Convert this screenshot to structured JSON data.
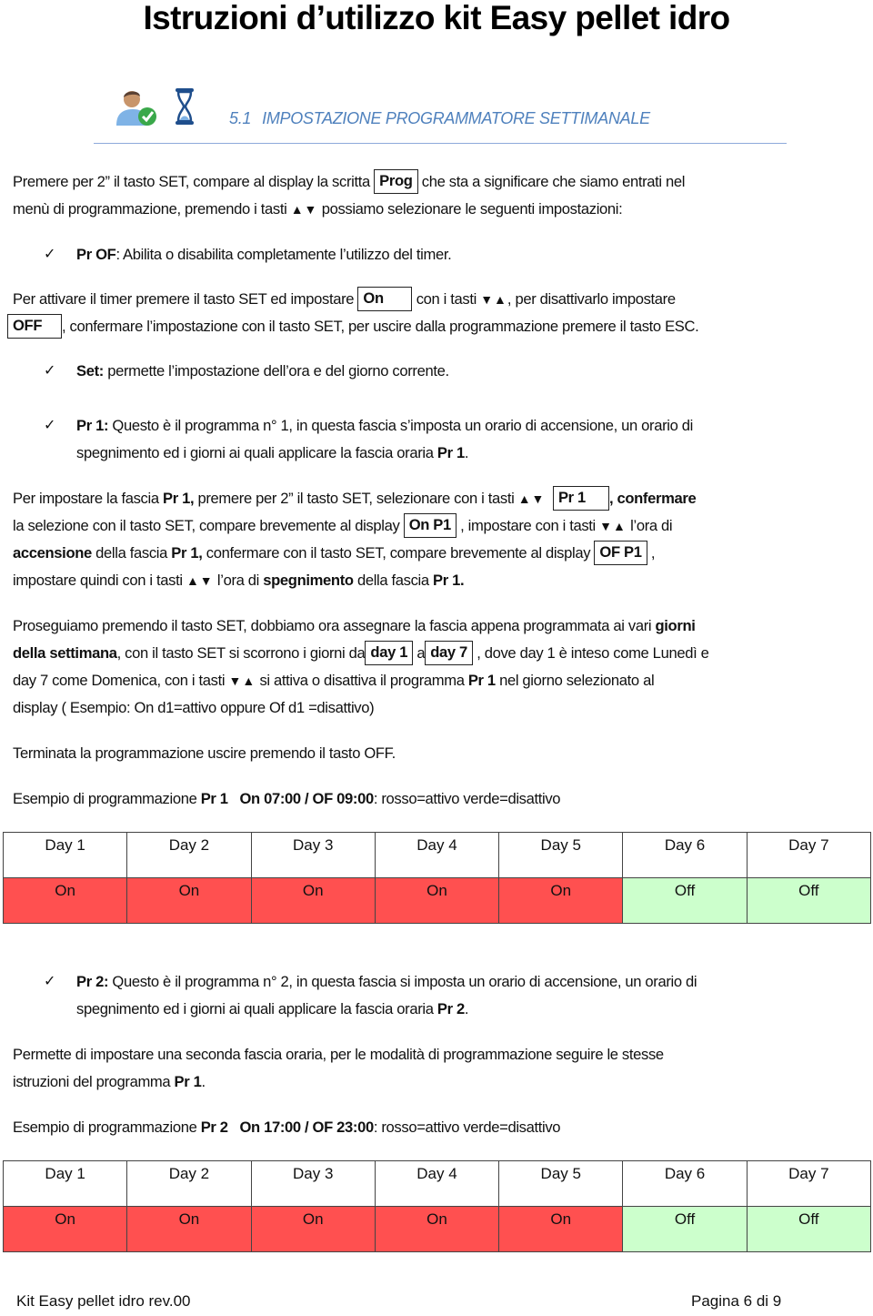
{
  "document": {
    "title": "Istruzioni d’utilizzo kit Easy pellet idro",
    "section": {
      "number": "5.1",
      "title": "IMPOSTAZIONE PROGRAMMATORE SETTIMANALE",
      "color": "#4f81bd"
    },
    "arrows": {
      "up_down": "▲▼",
      "down_up": "▼▲"
    },
    "check": "✓",
    "intro": {
      "l1a": "Premere per 2” il tasto  SET, compare al display la scritta",
      "box": "Prog",
      "l1b": "che sta a significare che siamo entrati nel",
      "l2a": "menù di programmazione, premendo i tasti",
      "l2b": "possiamo selezionare le seguenti impostazioni:"
    },
    "bullet_prof": {
      "label": "Pr  OF",
      "text": ": Abilita o disabilita completamente l’utilizzo del timer."
    },
    "timer": {
      "l1a": "Per attivare il timer premere il tasto SET ed impostare",
      "box_on": "On",
      "l1b": "con i tasti",
      "l1c": ", per disattivarlo impostare",
      "box_off": "OFF",
      "l2": ", confermare l’impostazione con il tasto SET,  per uscire dalla programmazione premere il tasto ESC."
    },
    "bullet_set": {
      "label": "Set:",
      "text": " permette l’impostazione dell’ora e del giorno corrente."
    },
    "bullet_pr1": {
      "label": "Pr  1:",
      "l1": " Questo è il programma  n° 1, in questa fascia s’imposta un orario di accensione, un orario di",
      "l2a": "spegnimento ed i giorni ai quali applicare la fascia oraria ",
      "l2b": "Pr 1",
      "l2c": "."
    },
    "pr1_setup": {
      "l1a": "Per impostare la fascia ",
      "l1b": "Pr 1,",
      "l1c": " premere per 2” il tasto SET, selezionare con i tasti",
      "box_pr1": "Pr 1",
      "l1d": ", confermare",
      "l2a": "la selezione con il tasto SET, compare brevemente al display",
      "box_onp1": "On P1",
      "l2b": ", impostare con i tasti",
      "l2c": "l’ora di",
      "l3a": "accensione",
      "l3b": " della fascia ",
      "l3c": "Pr 1,",
      "l3d": " confermare con il tasto SET, compare brevemente al display",
      "box_ofp1": "OF  P1",
      "l3e": ",",
      "l4a": "impostare quindi con i tasti",
      "l4b": "l’ora di ",
      "l4c": "spegnimento",
      "l4d": " della fascia ",
      "l4e": "Pr 1."
    },
    "days_para": {
      "l1a": "Proseguiamo premendo il tasto SET, dobbiamo ora assegnare la fascia appena programmata ai vari ",
      "l1b": "giorni",
      "l2a": "della settimana",
      "l2b": ", con il tasto SET si scorrono i giorni da",
      "box_day1": "day 1",
      "l2c": "a",
      "box_day7": "day 7",
      "l2d": ", dove day 1 è inteso come Lunedì e",
      "l3a": "day 7 come Domenica, con i tasti",
      "l3b": "si attiva o disattiva il programma ",
      "l3c": "Pr 1",
      "l3d": " nel giorno selezionato al",
      "l4": "display ( Esempio: On d1=attivo oppure Of d1 =disattivo)"
    },
    "exit_line": "Terminata la programmazione uscire premendo il tasto OFF.",
    "example1": {
      "prefix": "Esempio di programmazione ",
      "prog": "Pr 1",
      "times": "On 07:00  /  OF  09:00",
      "legend": ":    rosso=attivo    verde=disattivo"
    },
    "table1": {
      "headers": [
        "Day 1",
        "Day 2",
        "Day 3",
        "Day 4",
        "Day 5",
        "Day 6",
        "Day 7"
      ],
      "values": [
        "On",
        "On",
        "On",
        "On",
        "On",
        "Off",
        "Off"
      ]
    },
    "bullet_pr2": {
      "label": "Pr  2:",
      "l1": " Questo è il programma  n° 2, in questa fascia si imposta un orario di accensione, un orario di",
      "l2a": "spegnimento ed i giorni ai quali applicare la fascia oraria ",
      "l2b": "Pr 2",
      "l2c": "."
    },
    "pr2_para": {
      "l1": "Permette di impostare una seconda fascia oraria, per le modalità di programmazione seguire le stesse",
      "l2a": "istruzioni del programma ",
      "l2b": "Pr 1",
      "l2c": "."
    },
    "example2": {
      "prefix": "Esempio di programmazione ",
      "prog": "Pr 2",
      "times": "On 17:00  / OF  23:00",
      "legend": ":    rosso=attivo    verde=disattivo"
    },
    "table2": {
      "headers": [
        "Day 1",
        "Day 2",
        "Day 3",
        "Day 4",
        "Day 5",
        "Day 6",
        "Day 7"
      ],
      "values": [
        "On",
        "On",
        "On",
        "On",
        "On",
        "Off",
        "Off"
      ]
    },
    "colors": {
      "active": "#ff5050",
      "inactive": "#ccffcc"
    },
    "footer": {
      "left": "Kit Easy pellet idro  rev.00",
      "right": "Pagina 6 di 9"
    }
  }
}
